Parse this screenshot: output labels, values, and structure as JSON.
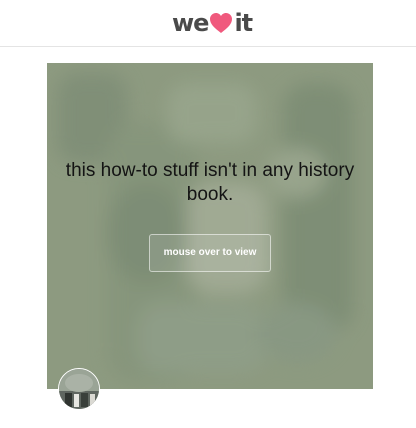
{
  "header": {
    "logo": {
      "left_text": "we",
      "right_text": "it",
      "heart_color": "#f0597d"
    }
  },
  "card": {
    "caption": "this how-to stuff isn't in any history book.",
    "hover_button_label": "mouse over to view",
    "background_color": "#8c9b80"
  },
  "icons": {
    "logo_heart": "heart-icon",
    "avatar": "user-avatar-photo"
  }
}
